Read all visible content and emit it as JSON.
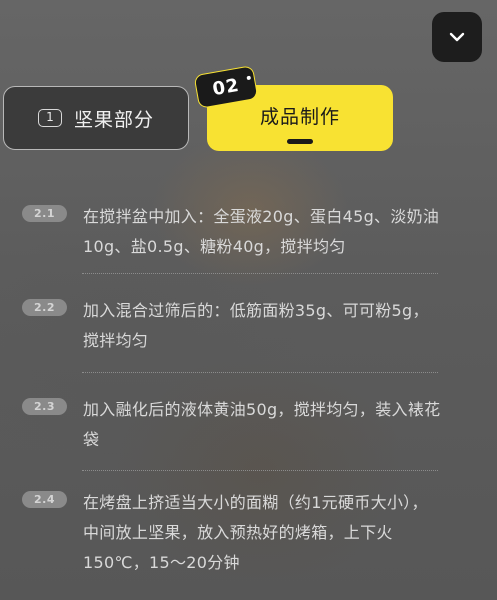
{
  "header": {
    "collapse_icon": "chevron-down-icon"
  },
  "tabs": [
    {
      "number": "1",
      "label": "坚果部分",
      "active": false
    },
    {
      "number": "02",
      "label": "成品制作",
      "active": true
    }
  ],
  "colors": {
    "accent": "#f8e232",
    "dark": "#1d1d1d",
    "text": "#d9d9d9"
  },
  "steps": [
    {
      "tag": "2.1",
      "text": "在搅拌盆中加入：全蛋液20g、蛋白45g、淡奶油10g、盐0.5g、糖粉40g，搅拌均匀"
    },
    {
      "tag": "2.2",
      "text": "加入混合过筛后的：低筋面粉35g、可可粉5g，搅拌均匀"
    },
    {
      "tag": "2.3",
      "text": "加入融化后的液体黄油50g，搅拌均匀，装入裱花袋"
    },
    {
      "tag": "2.4",
      "text": "在烤盘上挤适当大小的面糊（约1元硬币大小），中间放上坚果，放入预热好的烤箱，上下火150℃，15～20分钟"
    }
  ]
}
